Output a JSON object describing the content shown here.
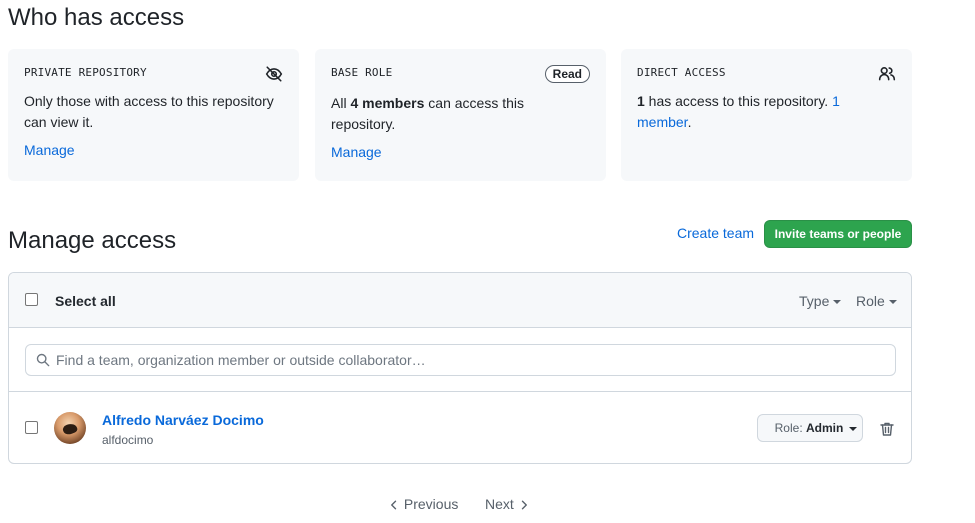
{
  "who_has_access": {
    "title": "Who has access",
    "cards": [
      {
        "title": "PRIVATE REPOSITORY",
        "text": "Only those with access to this repository can view it.",
        "link": "Manage",
        "icon": "eye-closed-icon"
      },
      {
        "title": "BASE ROLE",
        "badge": "Read",
        "text_prefix": "All ",
        "text_bold": "4 members",
        "text_suffix": " can access this repository.",
        "link": "Manage"
      },
      {
        "title": "DIRECT ACCESS",
        "text_bold": "1",
        "text_suffix": " has access to this repository. ",
        "link": "1 member",
        "link_suffix": ".",
        "icon": "people-icon"
      }
    ]
  },
  "manage_access": {
    "title": "Manage access",
    "create_team": "Create team",
    "invite_button": "Invite teams or people",
    "select_all": "Select all",
    "filters": {
      "type": "Type",
      "role": "Role"
    },
    "search_placeholder": "Find a team, organization member or outside collaborator…",
    "members": [
      {
        "name": "Alfredo Narváez Docimo",
        "login": "alfdocimo",
        "role_label": "Role:",
        "role": "Admin"
      }
    ]
  },
  "pagination": {
    "previous": "Previous",
    "next": "Next"
  },
  "colors": {
    "accent": "#0969da",
    "primary_button": "#2da44e"
  }
}
